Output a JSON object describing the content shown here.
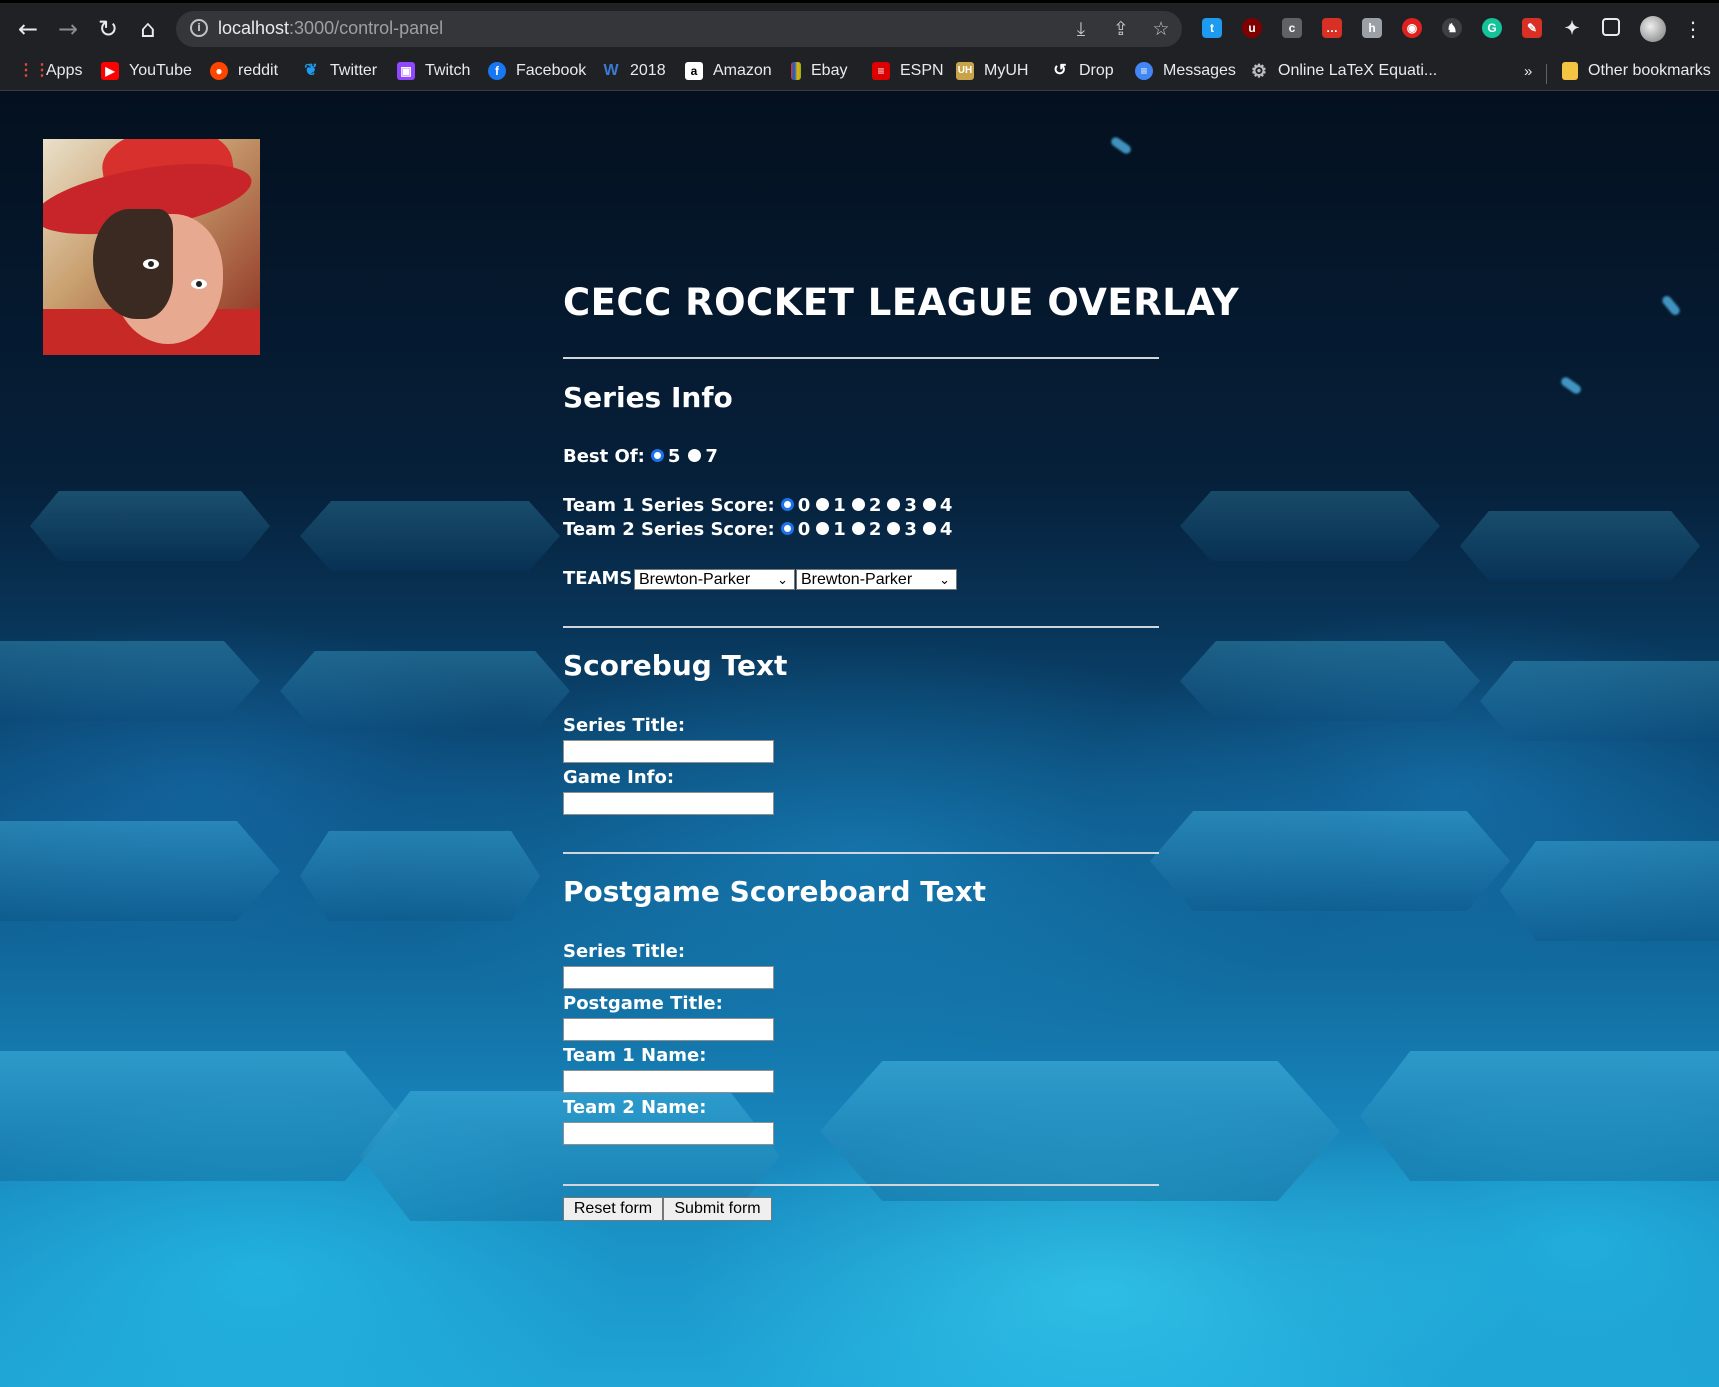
{
  "browser": {
    "url_host": "localhost",
    "url_path": ":3000/control-panel",
    "bookmarks": [
      {
        "label": "Apps",
        "icon": "apps-grid-icon",
        "color": "#e8453c"
      },
      {
        "label": "YouTube",
        "icon": "youtube-icon",
        "color": "#ff0000"
      },
      {
        "label": "reddit",
        "icon": "reddit-icon",
        "color": "#ff4500"
      },
      {
        "label": "Twitter",
        "icon": "twitter-icon",
        "color": "#1d9bf0"
      },
      {
        "label": "Twitch",
        "icon": "twitch-icon",
        "color": "#9146ff"
      },
      {
        "label": "Facebook",
        "icon": "facebook-icon",
        "color": "#1877f2"
      },
      {
        "label": "2018",
        "icon": "wordpress-icon",
        "color": "#3a7bd5"
      },
      {
        "label": "Amazon",
        "icon": "amazon-icon",
        "color": "#ffffff"
      },
      {
        "label": "Ebay",
        "icon": "ebay-icon",
        "color": "#f5af02"
      },
      {
        "label": "ESPN",
        "icon": "espn-icon",
        "color": "#d00"
      },
      {
        "label": "MyUH",
        "icon": "uh-icon",
        "color": "#c8a34a"
      },
      {
        "label": "Drop",
        "icon": "drop-icon",
        "color": "#ffffff"
      },
      {
        "label": "Messages",
        "icon": "messages-icon",
        "color": "#4285f4"
      },
      {
        "label": "Online LaTeX Equati...",
        "icon": "gear-icon",
        "color": "#bdbdbd"
      }
    ],
    "overflow": "»",
    "other_bookmarks": "Other bookmarks"
  },
  "page": {
    "title": "CECC ROCKET LEAGUE OVERLAY",
    "series_info": {
      "heading": "Series Info",
      "best_of_label": "Best Of:",
      "best_of_options": [
        "5",
        "7"
      ],
      "best_of_selected": "5",
      "team1_label": "Team 1 Series Score:",
      "team2_label": "Team 2 Series Score:",
      "score_options": [
        "0",
        "1",
        "2",
        "3",
        "4"
      ],
      "team1_selected": "0",
      "team2_selected": "0",
      "teams_label": "TEAMS:",
      "team1_select": "Brewton-Parker",
      "team2_select": "Brewton-Parker"
    },
    "scorebug": {
      "heading": "Scorebug Text",
      "series_title_label": "Series Title:",
      "game_info_label": "Game Info:"
    },
    "postgame": {
      "heading": "Postgame Scoreboard Text",
      "series_title_label": "Series Title:",
      "postgame_title_label": "Postgame Title:",
      "team1_name_label": "Team 1 Name:",
      "team2_name_label": "Team 2 Name:"
    },
    "buttons": {
      "reset": "Reset form",
      "submit": "Submit form"
    }
  }
}
